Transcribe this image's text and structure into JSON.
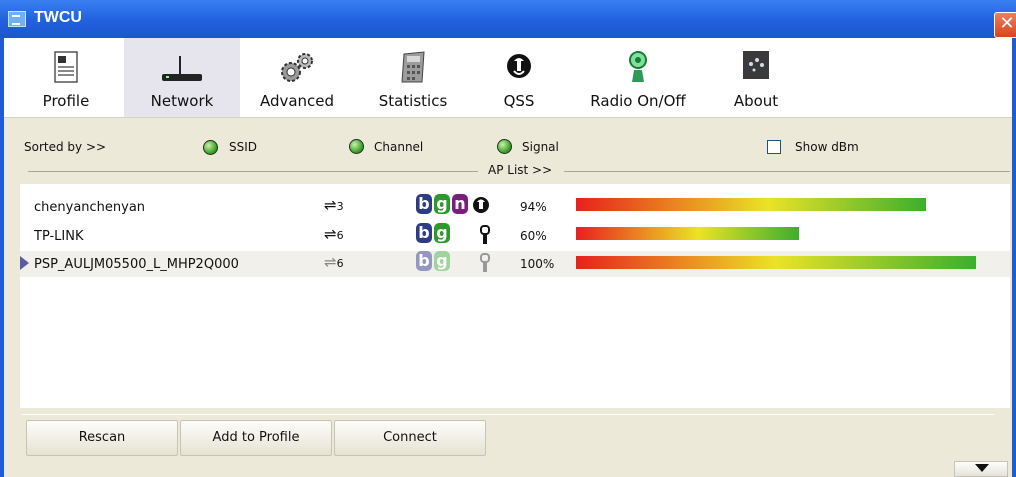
{
  "window": {
    "title": "TWCU",
    "close_glyph": "✕"
  },
  "toolbar": {
    "items": [
      {
        "label": "Profile",
        "icon": "profile-icon"
      },
      {
        "label": "Network",
        "icon": "router-icon",
        "active": true
      },
      {
        "label": "Advanced",
        "icon": "gears-icon"
      },
      {
        "label": "Statistics",
        "icon": "calculator-icon"
      },
      {
        "label": "QSS",
        "icon": "qss-icon"
      },
      {
        "label": "Radio On/Off",
        "icon": "radio-antenna-icon"
      },
      {
        "label": "About",
        "icon": "about-icon"
      }
    ]
  },
  "sort": {
    "label": "Sorted by >>",
    "options": [
      "SSID",
      "Channel",
      "Signal"
    ],
    "show_dbm_label": "Show dBm",
    "show_dbm_checked": false
  },
  "ap_list": {
    "label": "AP List >>",
    "rows": [
      {
        "ssid": "chenyanchenyan",
        "channel": "3",
        "modes": [
          "b",
          "g",
          "n"
        ],
        "wps": true,
        "secured": false,
        "signal_text": "94%",
        "signal": 0.94,
        "selected": false
      },
      {
        "ssid": "TP-LINK",
        "channel": "6",
        "modes": [
          "b",
          "g"
        ],
        "wps": false,
        "secured": true,
        "signal_text": "60%",
        "signal": 0.6,
        "selected": false
      },
      {
        "ssid": "PSP_AULJM05500_L_MHP2Q000",
        "channel": "6",
        "modes": [
          "b",
          "g"
        ],
        "wps": false,
        "secured": true,
        "signal_text": "100%",
        "signal": 1.0,
        "selected": true
      }
    ]
  },
  "buttons": {
    "rescan": "Rescan",
    "add_to_profile": "Add to Profile",
    "connect": "Connect"
  },
  "colors": {
    "titlebar": "#2262e0",
    "panel": "#ece9d8",
    "signal_start": "#e8201e",
    "signal_mid": "#ebe325",
    "signal_end": "#3cae2e"
  }
}
